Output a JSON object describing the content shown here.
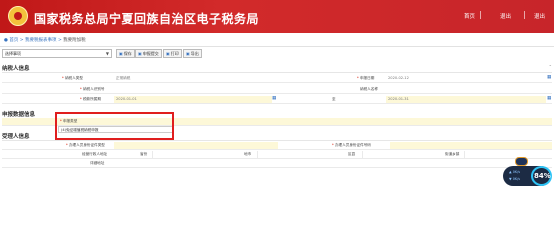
{
  "header": {
    "site_title": "国家税务总局宁夏回族自治区电子税务局",
    "user_label": "退出",
    "home_link": "首页",
    "logout": "退出"
  },
  "breadcrumb": {
    "home": "首页",
    "sep": " > ",
    "level1": "我要税报表事项",
    "level2": "我要附加税"
  },
  "toolbar": {
    "select_value": "选择事项",
    "buttons": [
      "保存",
      "申报提交",
      "打印",
      "导出"
    ]
  },
  "taxpayer_section": {
    "title": "纳税人信息",
    "fields": [
      {
        "label": "纳税人类型",
        "value": "正常纳税"
      },
      {
        "label": "申报日期",
        "value": "2020-02-12"
      },
      {
        "label": "纳税人识别号",
        "value": ""
      },
      {
        "label": "纳税人名称",
        "value": ""
      },
      {
        "label": "税款所属期",
        "value": "2020-01-01"
      },
      {
        "label": "至",
        "value": "2020-01-31"
      }
    ]
  },
  "declaration_section": {
    "title": "申报数据信息",
    "fields": [
      {
        "label": "申报类型",
        "value": ""
      },
      {
        "label": "",
        "value": "(4)免征增值税纳税申报"
      }
    ]
  },
  "agent_section": {
    "title": "受理人信息",
    "fields": [
      {
        "label": "办理人员身份证件类型",
        "value": ""
      },
      {
        "label": "办理人员身份证件号码",
        "value": ""
      },
      {
        "label": "经营行政人地址",
        "value": ""
      },
      {
        "label": "省份",
        "value": ""
      },
      {
        "label": "地市",
        "value": ""
      },
      {
        "label": "区县",
        "value": ""
      },
      {
        "label": "街道乡镇",
        "value": ""
      },
      {
        "label": "详细地址",
        "value": ""
      }
    ]
  },
  "widget": {
    "percent": "84%",
    "row1": "0K/s",
    "row2": "0K/s"
  },
  "colors": {
    "header_red": "#c01818",
    "link_blue": "#3773c0",
    "highlight_red": "#e01e1e",
    "field_yellow": "#fdf8d8"
  }
}
